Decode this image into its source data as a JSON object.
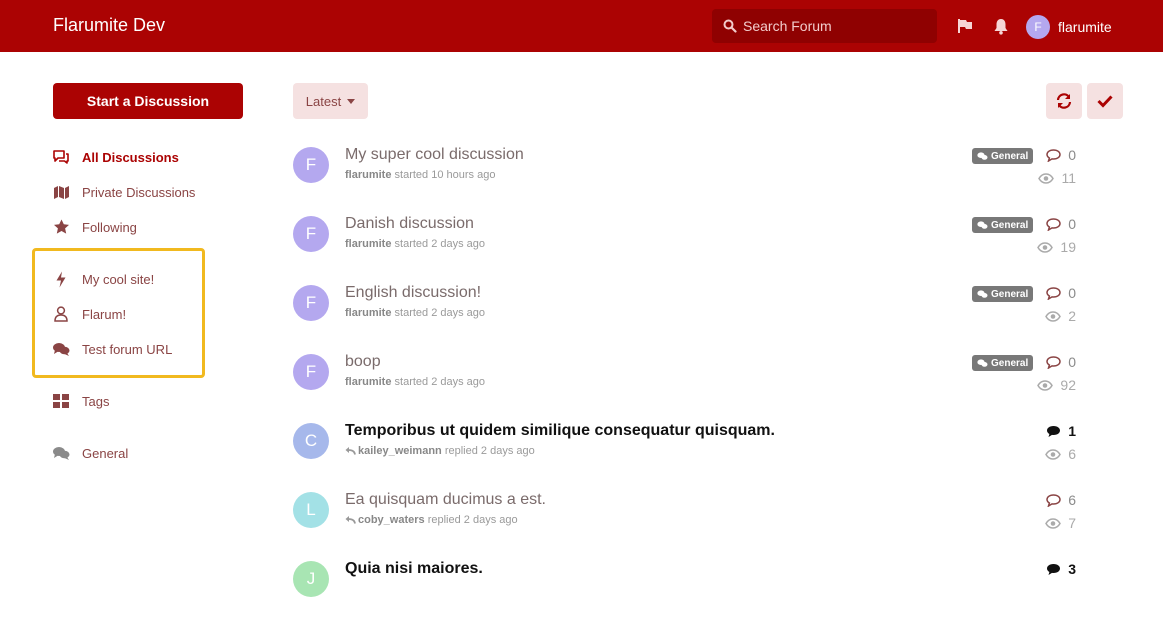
{
  "header": {
    "brand": "Flarumite Dev",
    "search_placeholder": "Search Forum",
    "user_initial": "F",
    "user_name": "flarumite"
  },
  "sidebar": {
    "start_button": "Start a Discussion",
    "nav": [
      {
        "label": "All Discussions",
        "icon": "comments-icon",
        "active": true
      },
      {
        "label": "Private Discussions",
        "icon": "map-icon"
      },
      {
        "label": "Following",
        "icon": "star-icon"
      },
      {
        "label": "My cool site!",
        "icon": "bolt-icon"
      },
      {
        "label": "Flarum!",
        "icon": "user-icon"
      },
      {
        "label": "Test forum URL",
        "icon": "chat-icon"
      },
      {
        "label": "Tags",
        "icon": "grid-icon"
      },
      {
        "label": "General",
        "icon": "chat-icon"
      }
    ]
  },
  "toolbar": {
    "sort_label": "Latest",
    "refresh_icon": "refresh-icon",
    "mark_read_icon": "check-icon"
  },
  "discussions": [
    {
      "initial": "F",
      "avatar_color": "#b4a8ef",
      "title": "My super cool discussion",
      "user": "flarumite",
      "action": "started 10 hours ago",
      "tag": "General",
      "replies": "0",
      "views": "11",
      "unread": false,
      "replied": false
    },
    {
      "initial": "F",
      "avatar_color": "#b4a8ef",
      "title": "Danish discussion",
      "user": "flarumite",
      "action": "started 2 days ago",
      "tag": "General",
      "replies": "0",
      "views": "19",
      "unread": false,
      "replied": false
    },
    {
      "initial": "F",
      "avatar_color": "#b4a8ef",
      "title": "English discussion!",
      "user": "flarumite",
      "action": "started 2 days ago",
      "tag": "General",
      "replies": "0",
      "views": "2",
      "unread": false,
      "replied": false
    },
    {
      "initial": "F",
      "avatar_color": "#b4a8ef",
      "title": "boop",
      "user": "flarumite",
      "action": "started 2 days ago",
      "tag": "General",
      "replies": "0",
      "views": "92",
      "unread": false,
      "replied": false
    },
    {
      "initial": "C",
      "avatar_color": "#a6b8eb",
      "title": "Temporibus ut quidem similique consequatur quisquam.",
      "user": "kailey_weimann",
      "action": "replied 2 days ago",
      "tag": "",
      "replies": "1",
      "views": "6",
      "unread": true,
      "replied": true
    },
    {
      "initial": "L",
      "avatar_color": "#a3e1e6",
      "title": "Ea quisquam ducimus a est.",
      "user": "coby_waters",
      "action": "replied 2 days ago",
      "tag": "",
      "replies": "6",
      "views": "7",
      "unread": false,
      "replied": true
    },
    {
      "initial": "J",
      "avatar_color": "#a8e5b3",
      "title": "Quia nisi maiores.",
      "user": "",
      "action": "",
      "tag": "",
      "replies": "3",
      "views": "",
      "unread": true,
      "replied": false
    }
  ],
  "colors": {
    "primary": "#ab0303",
    "highlight_border": "#f1b91f"
  }
}
